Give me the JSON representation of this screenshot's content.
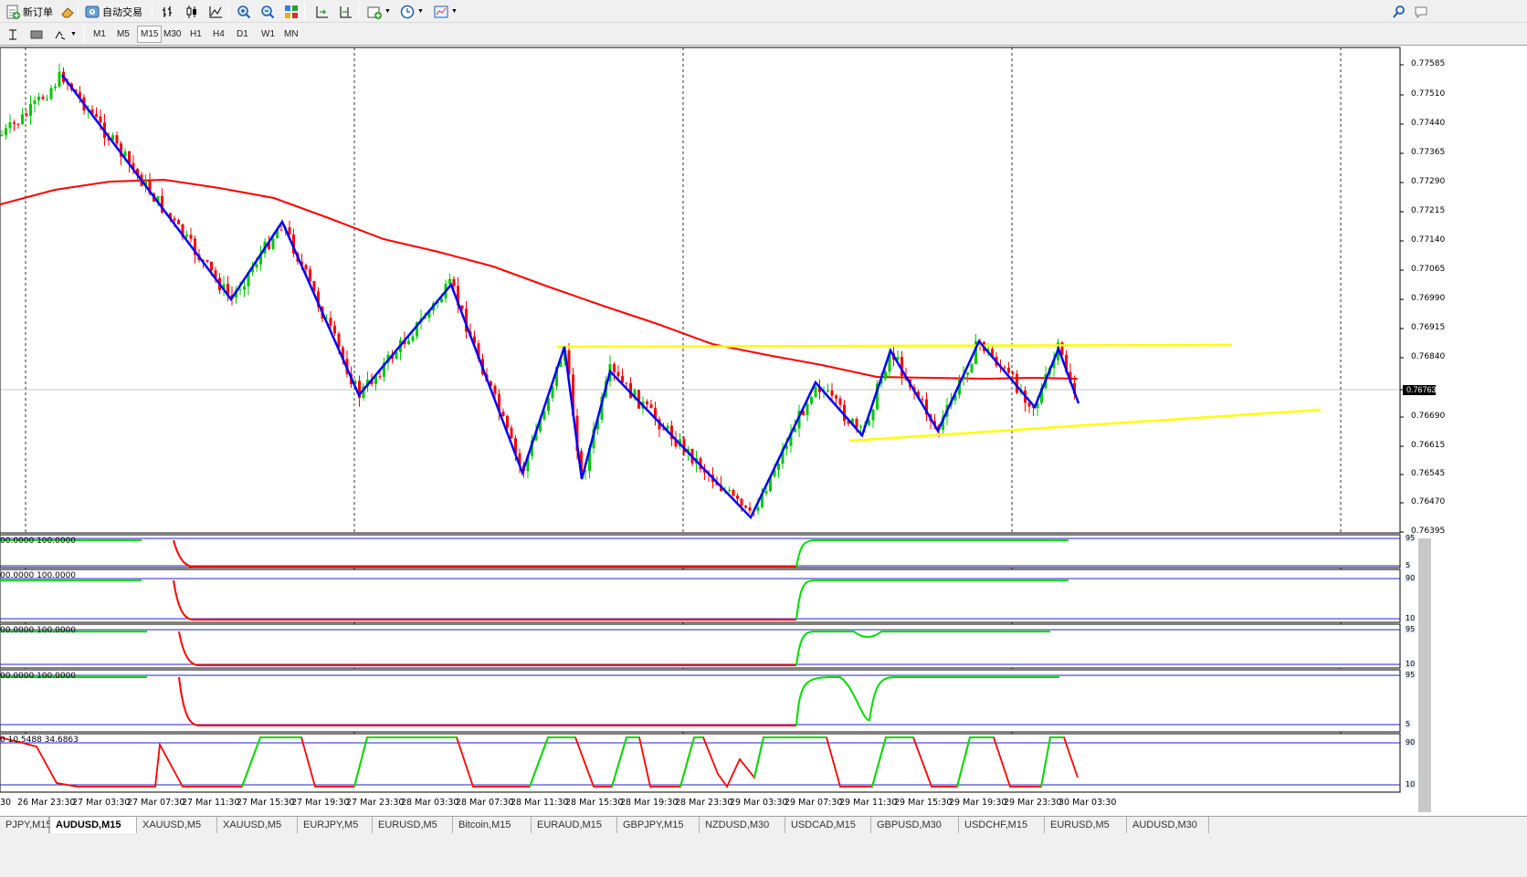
{
  "toolbar": {
    "new_order_label": "新订单",
    "auto_trading_label": "自动交易"
  },
  "timeframes": [
    "M1",
    "M5",
    "M15",
    "M30",
    "H1",
    "H4",
    "D1",
    "W1",
    "MN"
  ],
  "active_timeframe": "M15",
  "price_axis": [
    "0.77585",
    "0.77510",
    "0.77440",
    "0.77365",
    "0.77290",
    "0.77215",
    "0.77140",
    "0.77065",
    "0.76990",
    "0.76915",
    "0.76840",
    "0.76763",
    "0.76690",
    "0.76615",
    "0.76545",
    "0.76470",
    "0.76395"
  ],
  "current_price": "0.76763",
  "time_axis": [
    "30",
    "26 Mar 23:30",
    "27 Mar 03:30",
    "27 Mar 07:30",
    "27 Mar 11:30",
    "27 Mar 15:30",
    "27 Mar 19:30",
    "27 Mar 23:30",
    "28 Mar 03:30",
    "28 Mar 07:30",
    "28 Mar 11:30",
    "28 Mar 15:30",
    "28 Mar 19:30",
    "28 Mar 23:30",
    "29 Mar 03:30",
    "29 Mar 07:30",
    "29 Mar 11:30",
    "29 Mar 15:30",
    "29 Mar 19:30",
    "29 Mar 23:30",
    "30 Mar 03:30"
  ],
  "indicators": [
    {
      "label": "00.0000 100.0000",
      "levels": [
        "95",
        "5"
      ]
    },
    {
      "label": "00.0000 100.0000",
      "levels": [
        "90",
        "10"
      ]
    },
    {
      "label": "00.0000 100.0000",
      "levels": [
        "95",
        "10"
      ]
    },
    {
      "label": "00.0000 100.0000",
      "levels": [
        "95",
        "5"
      ]
    },
    {
      "label": "0 10.5488 34.6863",
      "levels": [
        "90",
        "10"
      ]
    }
  ],
  "tabs": [
    "PJPY,M15",
    "AUDUSD,M15",
    "XAUUSD,M5",
    "XAUUSD,M5",
    "EURJPY,M5",
    "EURUSD,M5",
    "Bitcoin,M15",
    "EURAUD,M15",
    "GBPJPY,M15",
    "NZDUSD,M30",
    "USDCAD,M15",
    "GBPUSD,M30",
    "USDCHF,M15",
    "EURUSD,M5",
    "AUDUSD,M30"
  ],
  "active_tab": "AUDUSD,M15",
  "colors": {
    "bull": "#00c800",
    "bear": "#ff0000",
    "zigzag": "#0000ff",
    "ma": "#ff0000",
    "trendline": "#ffff00"
  }
}
